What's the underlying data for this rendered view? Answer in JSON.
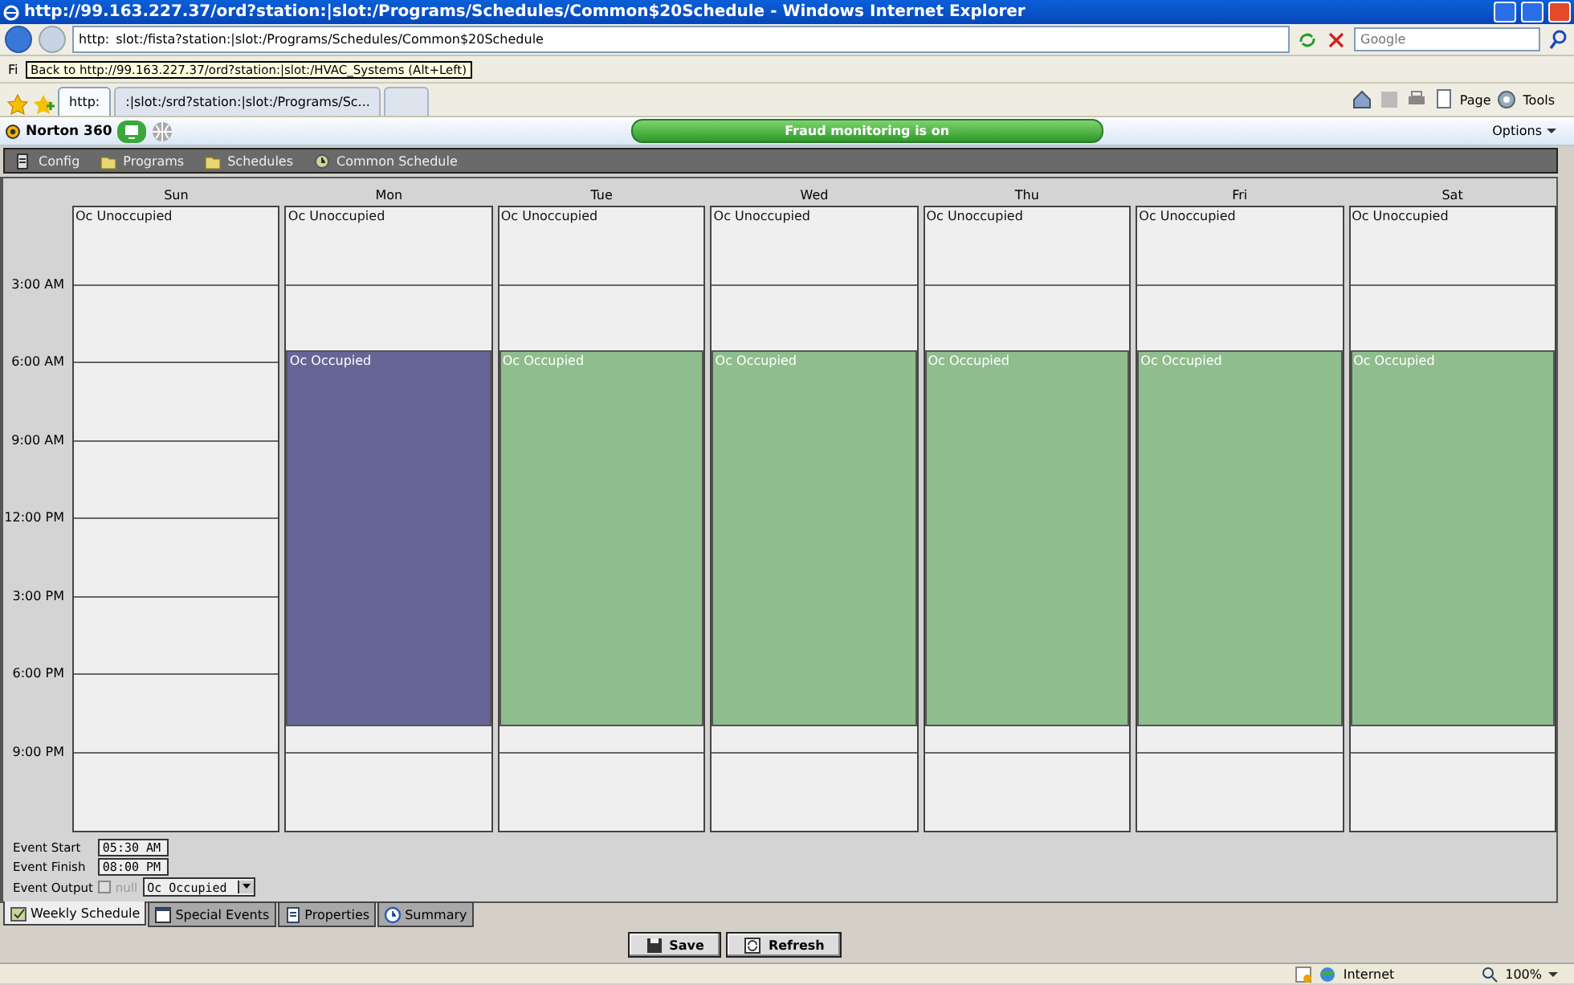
{
  "window": {
    "title": "http://99.163.227.37/ord?station:|slot:/Programs/Schedules/Common$20Schedule - Windows Internet Explorer"
  },
  "address_bar": {
    "prefix": "http:",
    "value": "slot:/fista?station:|slot:/Programs/Schedules/Common$20Schedule"
  },
  "search": {
    "placeholder": "Google"
  },
  "menu_bar": {
    "text": "Fi"
  },
  "tooltip": "Back to http://99.163.227.37/ord?station:|slot:/HVAC_Systems (Alt+Left)",
  "tabs": [
    {
      "label": "http:",
      "selected": true
    },
    {
      "label": ":|slot:/srd?station:|slot:/Programs/Sc...",
      "selected": false
    }
  ],
  "command_bar": [
    "Page",
    "Tools"
  ],
  "norton_bar": {
    "brand": "Norton 360",
    "status": "Fraud monitoring is on",
    "options": "Options"
  },
  "nav_bar": [
    {
      "label": "Config",
      "kind": "config"
    },
    {
      "label": "Programs",
      "kind": "folder"
    },
    {
      "label": "Schedules",
      "kind": "folder"
    },
    {
      "label": "Common Schedule",
      "kind": "schedule"
    }
  ],
  "schedule": {
    "time_labels": [
      "3:00 AM",
      "6:00 AM",
      "9:00 AM",
      "12:00 PM",
      "3:00 PM",
      "6:00 PM",
      "9:00 PM"
    ],
    "days": [
      {
        "name": "Sun",
        "events": [
          {
            "label": "Oc Unoccupied",
            "kind": "unoccupied",
            "selected": false
          }
        ]
      },
      {
        "name": "Mon",
        "events": [
          {
            "label": "Oc Unoccupied",
            "kind": "unoccupied",
            "selected": false
          },
          {
            "label": "Oc Occupied",
            "kind": "occupied",
            "selected": true
          }
        ]
      },
      {
        "name": "Tue",
        "events": [
          {
            "label": "Oc Unoccupied",
            "kind": "unoccupied",
            "selected": false
          },
          {
            "label": "Oc Occupied",
            "kind": "occupied",
            "selected": false
          }
        ]
      },
      {
        "name": "Wed",
        "events": [
          {
            "label": "Oc Unoccupied",
            "kind": "unoccupied",
            "selected": false
          },
          {
            "label": "Oc Occupied",
            "kind": "occupied",
            "selected": false
          }
        ]
      },
      {
        "name": "Thu",
        "events": [
          {
            "label": "Oc Unoccupied",
            "kind": "unoccupied",
            "selected": false
          },
          {
            "label": "Oc Occupied",
            "kind": "occupied",
            "selected": false
          }
        ]
      },
      {
        "name": "Fri",
        "events": [
          {
            "label": "Oc Unoccupied",
            "kind": "unoccupied",
            "selected": false
          },
          {
            "label": "Oc Occupied",
            "kind": "occupied",
            "selected": false
          }
        ]
      },
      {
        "name": "Sat",
        "events": [
          {
            "label": "Oc Unoccupied",
            "kind": "unoccupied",
            "selected": false
          },
          {
            "label": "Oc Occupied",
            "kind": "occupied",
            "selected": false
          }
        ]
      }
    ]
  },
  "event_editor": {
    "start_label": "Event Start",
    "start": "05:30 AM",
    "finish_label": "Event Finish",
    "finish": "08:00 PM",
    "output_label": "Event Output",
    "null_label": "null",
    "null_checked": false,
    "output": "Oc Occupied"
  },
  "view_tabs": [
    {
      "label": "Weekly Schedule",
      "kind": "weekly",
      "selected": true
    },
    {
      "label": "Special Events",
      "kind": "special",
      "selected": false
    },
    {
      "label": "Properties",
      "kind": "properties",
      "selected": false
    },
    {
      "label": "Summary",
      "kind": "summary",
      "selected": false
    }
  ],
  "buttons": [
    {
      "label": "Save",
      "kind": "save"
    },
    {
      "label": "Refresh",
      "kind": "refresh"
    }
  ],
  "status_bar": {
    "zone": "Internet",
    "zoom": "100%"
  }
}
